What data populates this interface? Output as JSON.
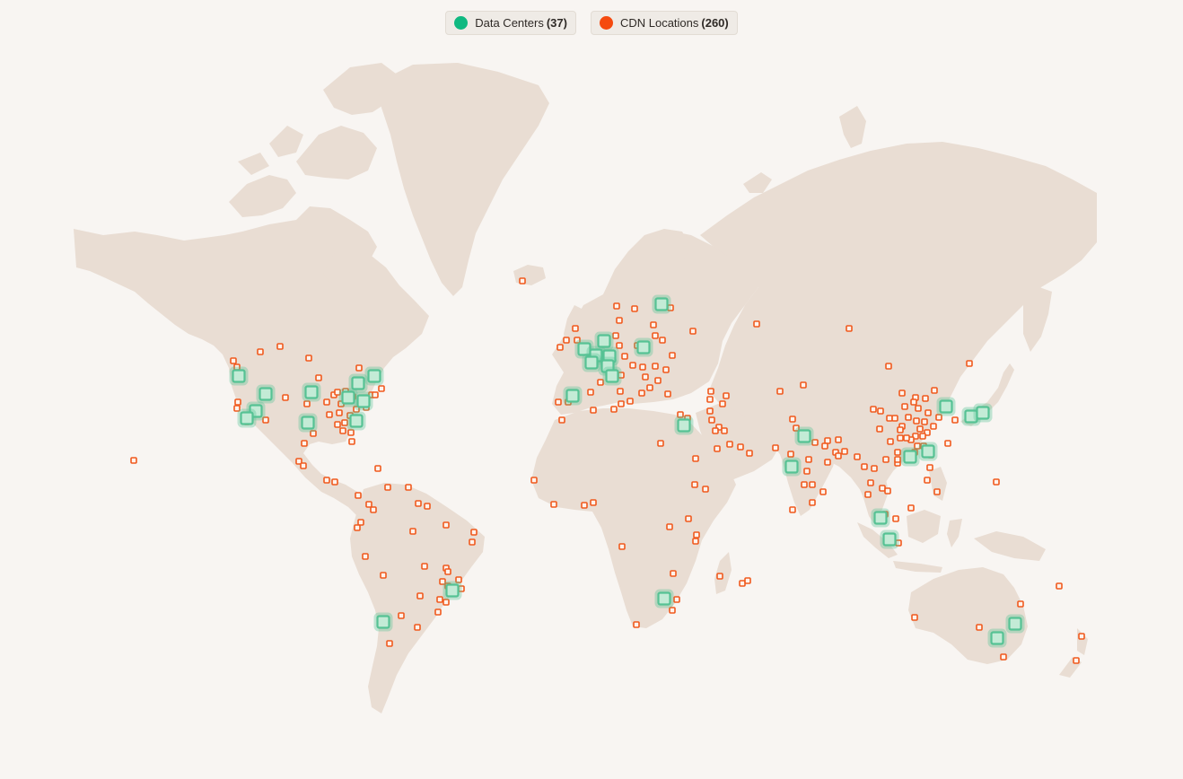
{
  "legend": {
    "data_centers": {
      "label": "Data Centers",
      "count": "(37)",
      "color": "#10b981"
    },
    "cdn_locations": {
      "label": "CDN Locations",
      "count": "(260)",
      "color": "#f54a0f"
    }
  },
  "colors": {
    "land": "#e9ddd3",
    "background": "#f8f5f2",
    "dc_fill": "#c3ebd6",
    "dc_stroke": "#56c294",
    "cdn_stroke": "#f05a1e"
  }
}
